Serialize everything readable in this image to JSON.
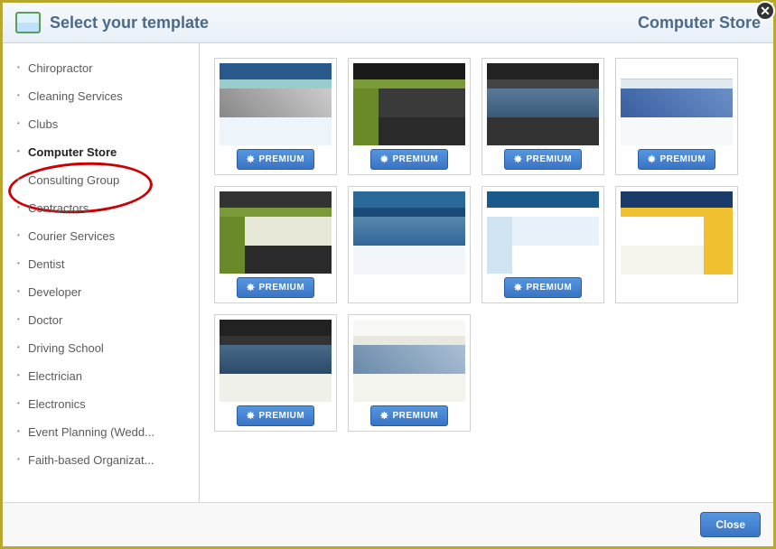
{
  "header": {
    "title": "Select your template",
    "context": "Computer Store"
  },
  "sidebar": {
    "items": [
      {
        "label": "Chiropractor",
        "selected": false
      },
      {
        "label": "Cleaning Services",
        "selected": false
      },
      {
        "label": "Clubs",
        "selected": false
      },
      {
        "label": "Computer Store",
        "selected": true
      },
      {
        "label": "Consulting Group",
        "selected": false
      },
      {
        "label": "Contractors",
        "selected": false
      },
      {
        "label": "Courier Services",
        "selected": false
      },
      {
        "label": "Dentist",
        "selected": false
      },
      {
        "label": "Developer",
        "selected": false
      },
      {
        "label": "Doctor",
        "selected": false
      },
      {
        "label": "Driving School",
        "selected": false
      },
      {
        "label": "Electrician",
        "selected": false
      },
      {
        "label": "Electronics",
        "selected": false
      },
      {
        "label": "Event Planning (Wedd...",
        "selected": false
      },
      {
        "label": "Faith-based Organizat...",
        "selected": false
      }
    ]
  },
  "templates": [
    {
      "variant": "v1",
      "premium": true
    },
    {
      "variant": "v2",
      "premium": true
    },
    {
      "variant": "v3",
      "premium": true
    },
    {
      "variant": "v4",
      "premium": true
    },
    {
      "variant": "v5",
      "premium": true
    },
    {
      "variant": "v6",
      "premium": false
    },
    {
      "variant": "v7",
      "premium": true
    },
    {
      "variant": "v8",
      "premium": false
    },
    {
      "variant": "v9",
      "premium": true
    },
    {
      "variant": "v10",
      "premium": true
    }
  ],
  "labels": {
    "premium": "PREMIUM",
    "close": "Close"
  }
}
